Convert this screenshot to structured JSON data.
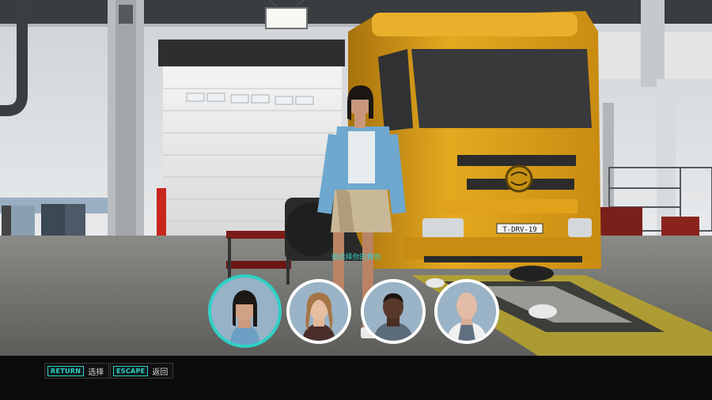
{
  "prompt": {
    "text": "请选择你的角色"
  },
  "truck": {
    "plate": "T-DRV-19"
  },
  "characters": [
    {
      "id": "female-asian",
      "selected": true
    },
    {
      "id": "female-blonde",
      "selected": false
    },
    {
      "id": "male-dark",
      "selected": false
    },
    {
      "id": "male-bald",
      "selected": false
    }
  ],
  "controls": [
    {
      "key": "RETURN",
      "label": "选择"
    },
    {
      "key": "ESCAPE",
      "label": "返回"
    }
  ],
  "colors": {
    "accent": "#2fd0c6",
    "truck": "#e0a21a",
    "bar": "#0b0b0c"
  }
}
